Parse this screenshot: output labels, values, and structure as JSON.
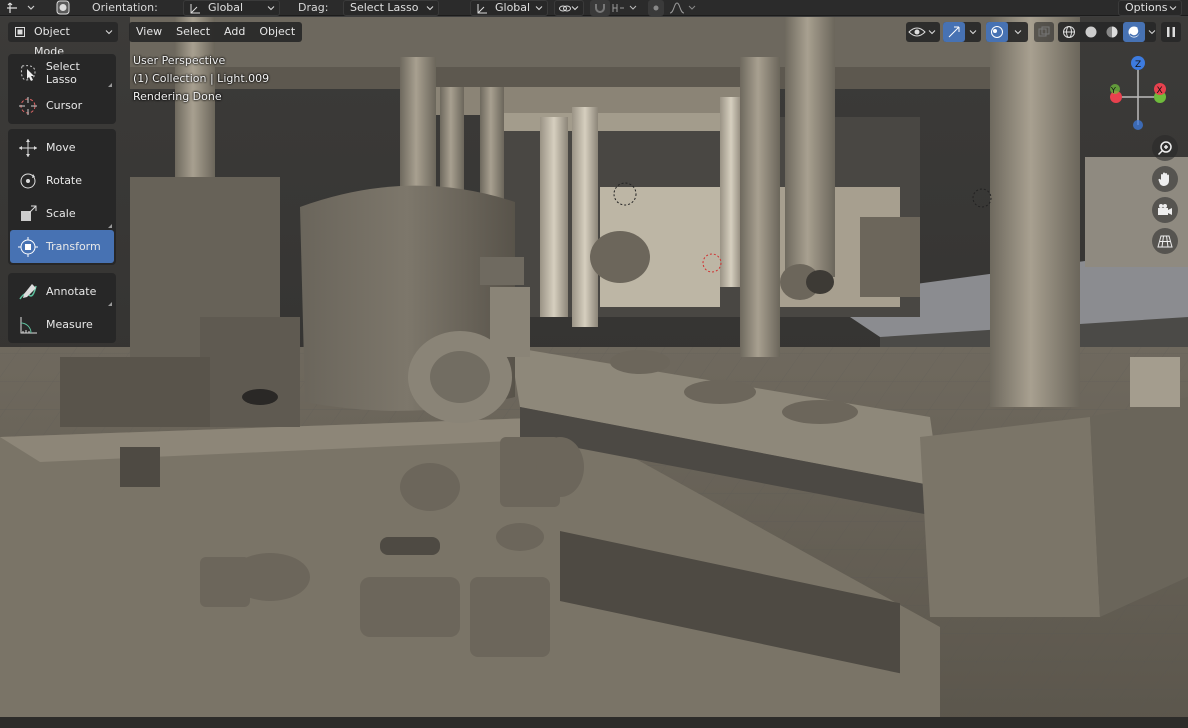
{
  "header": {
    "orientation_label": "Orientation:",
    "orientation_value": "Global",
    "drag_label": "Drag:",
    "drag_value": "Select Lasso",
    "pivot_value": "Global",
    "options_label": "Options"
  },
  "viewport_header": {
    "mode": "Object Mode",
    "menus": [
      "View",
      "Select",
      "Add",
      "Object"
    ]
  },
  "overlay": {
    "line1": "User Perspective",
    "line2": "(1) Collection | Light.009",
    "line3": "Rendering Done"
  },
  "toolbar": {
    "group1": [
      "Select Lasso",
      "Cursor"
    ],
    "group2": [
      "Move",
      "Rotate",
      "Scale",
      "Transform"
    ],
    "group3": [
      "Annotate",
      "Measure"
    ],
    "active": "Transform"
  },
  "gizmo": {
    "x_label": "X",
    "y_label": "Y",
    "z_label": "Z",
    "x_color": "#e8414e",
    "y_color": "#6fbb3c",
    "z_color": "#3d7bdf"
  },
  "colors": {
    "accent": "#4772b3",
    "header_bg": "#2b2b2b"
  }
}
